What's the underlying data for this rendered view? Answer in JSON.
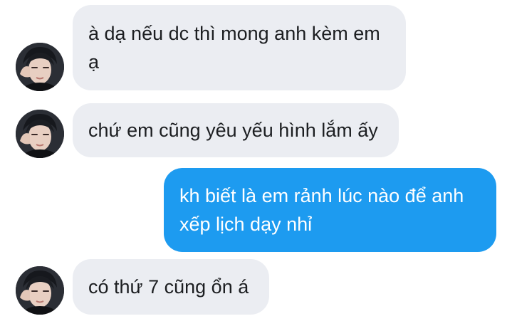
{
  "conversation": {
    "messages": [
      {
        "direction": "incoming",
        "lines": [
          "à dạ nếu dc thì mong anh kèm em",
          "ạ"
        ]
      },
      {
        "direction": "incoming",
        "lines": [
          "chứ em cũng yêu yếu hình lắm ấy"
        ]
      },
      {
        "direction": "outgoing",
        "lines": [
          "kh biết là em rảnh lúc nào để anh",
          "xếp lịch dạy nhỉ"
        ]
      },
      {
        "direction": "incoming",
        "lines": [
          "có thứ 7 cũng ổn á"
        ]
      }
    ]
  },
  "colors": {
    "incoming_bubble": "#ebedf2",
    "outgoing_bubble": "#1d9bf0",
    "incoming_text": "#1c1e21",
    "outgoing_text": "#ffffff"
  },
  "icons": {
    "avatar": "contact-avatar-photo"
  }
}
